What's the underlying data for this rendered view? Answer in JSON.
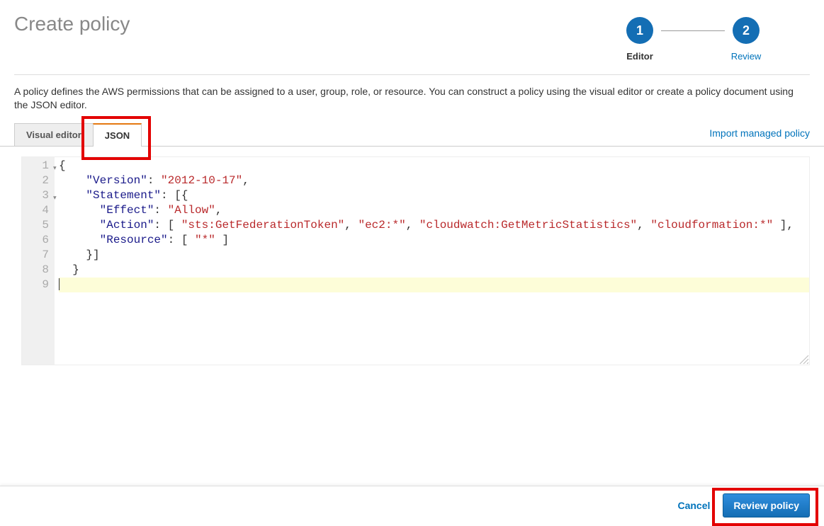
{
  "header": {
    "title": "Create policy"
  },
  "stepper": {
    "step1": {
      "num": "1",
      "label": "Editor"
    },
    "step2": {
      "num": "2",
      "label": "Review"
    }
  },
  "description": "A policy defines the AWS permissions that can be assigned to a user, group, role, or resource. You can construct a policy using the visual editor or create a policy document using the JSON editor.",
  "tabs": {
    "visual": "Visual editor",
    "json": "JSON"
  },
  "import_link": "Import managed policy",
  "editor": {
    "gutter": [
      "1",
      "2",
      "3",
      "4",
      "5",
      "6",
      "7",
      "8",
      "9"
    ],
    "lines": {
      "l1": {
        "t1": "{"
      },
      "l2": {
        "k1": "\"Version\"",
        "p1": ": ",
        "s1": "\"2012-10-17\"",
        "p2": ","
      },
      "l3": {
        "k1": "\"Statement\"",
        "p1": ": [{"
      },
      "l4": {
        "k1": "\"Effect\"",
        "p1": ": ",
        "s1": "\"Allow\"",
        "p2": ","
      },
      "l5": {
        "k1": "\"Action\"",
        "p1": ": [ ",
        "s1": "\"sts:GetFederationToken\"",
        "p2": ", ",
        "s2": "\"ec2:*\"",
        "p3": ", ",
        "s3": "\"cloudwatch:GetMetricStatistics\"",
        "p4": ", ",
        "s4": "\"cloudformation:*\"",
        "p5": " ],"
      },
      "l6": {
        "k1": "\"Resource\"",
        "p1": ": [ ",
        "s1": "\"*\"",
        "p2": " ]"
      },
      "l7": {
        "t1": "}]"
      },
      "l8": {
        "t1": "}"
      }
    }
  },
  "footer": {
    "cancel": "Cancel",
    "review": "Review policy"
  }
}
